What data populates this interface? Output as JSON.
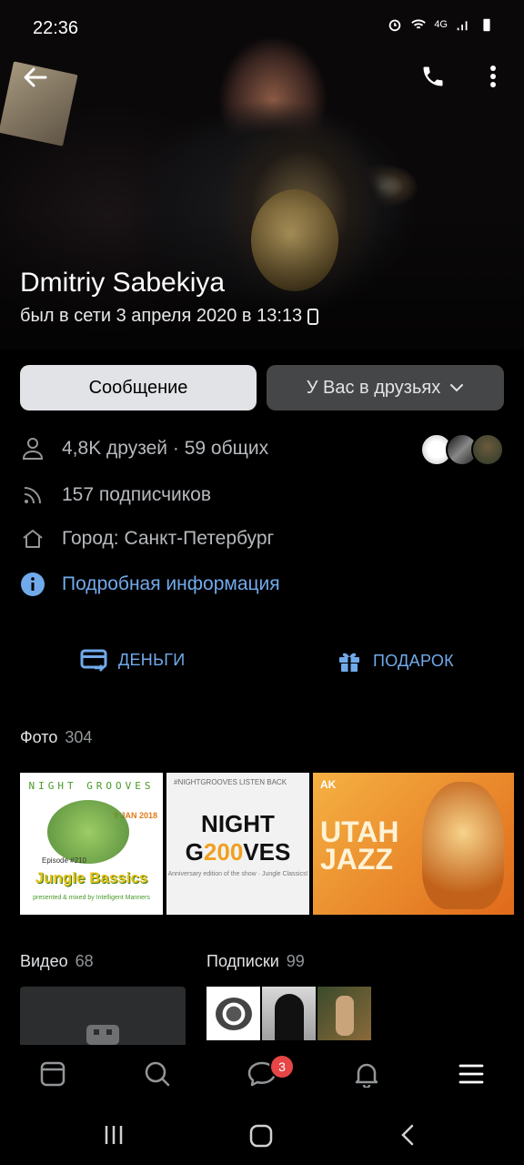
{
  "status_bar": {
    "time": "22:36",
    "network": "4G"
  },
  "profile": {
    "name": "Dmitriy Sabekiya",
    "last_seen": "был в сети 3 апреля 2020 в 13:13"
  },
  "buttons": {
    "message": "Сообщение",
    "friends": "У Вас в друзьях"
  },
  "info": {
    "friends": "4,8K друзей · 59 общих",
    "subscribers": "157 подписчиков",
    "city": "Город: Санкт-Петербург",
    "details_link": "Подробная информация"
  },
  "actions": {
    "money": "ДЕНЬГИ",
    "gift": "ПОДАРОК"
  },
  "photos": {
    "title": "Фото",
    "count": "304",
    "items": [
      {
        "header": "NIGHT GROOVES",
        "date": "9 JAN 2018",
        "episode": "Episode #210",
        "title": "Jungle Bassics",
        "footer": "presented & mixed by Intelligent Manners"
      },
      {
        "header": "#NIGHTGROOVES LISTEN BACK",
        "line1": "NIGHT",
        "line2_a": "G",
        "line2_b": "200",
        "line2_c": "VES",
        "sub": "Anniversary edition of the show · Jungle Classics!"
      },
      {
        "brand": "AK",
        "line1": "UTAH",
        "line2": "JAZZ"
      }
    ]
  },
  "videos": {
    "title": "Видео",
    "count": "68"
  },
  "subscriptions": {
    "title": "Подписки",
    "count": "99"
  },
  "bottom_nav": {
    "messages_badge": "3"
  },
  "colors": {
    "accent": "#71aaeb",
    "badge": "#e64646",
    "background": "#000000"
  }
}
